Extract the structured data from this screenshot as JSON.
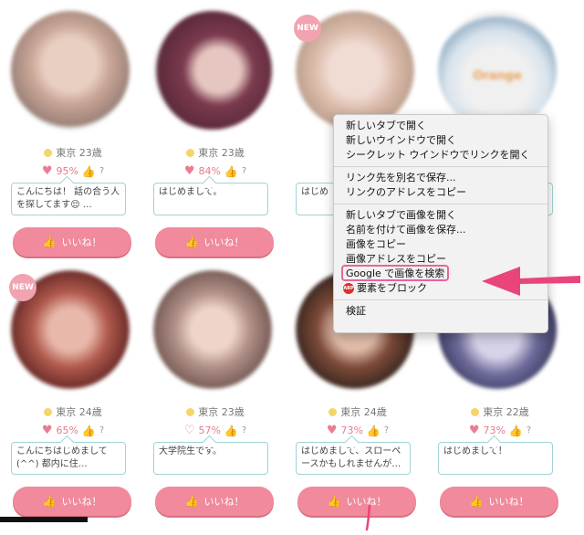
{
  "cards": [
    {
      "new": "",
      "location": "東京 23歳",
      "rate": "95%",
      "question": "?",
      "message": "こんにちは！ 話の合う人を探してます😌 …",
      "like_label": "いいね！"
    },
    {
      "new": "",
      "location": "東京 23歳",
      "rate": "84%",
      "question": "?",
      "message": "はじめまして。",
      "like_label": "いいね！"
    },
    {
      "new": "NEW",
      "location": "",
      "rate": "",
      "question": "",
      "message": "はじめ",
      "like_label": ""
    },
    {
      "new": "",
      "location": "",
      "rate": "",
      "question": "",
      "message": "合",
      "like_label": ""
    },
    {
      "new": "NEW",
      "location": "東京 24歳",
      "rate": "65%",
      "question": "?",
      "message": "こんにちはじめまして(^^) 都内に住…",
      "like_label": "いいね！"
    },
    {
      "new": "",
      "location": "東京 23歳",
      "rate": "57%",
      "question": "?",
      "message": "大学院生です。",
      "like_label": "いいね！"
    },
    {
      "new": "",
      "location": "東京 24歳",
      "rate": "73%",
      "question": "?",
      "message": "はじめまして、スローペースかもしれませんが…",
      "like_label": "いいね！"
    },
    {
      "new": "",
      "location": "東京 22歳",
      "rate": "73%",
      "question": "?",
      "message": "はじめまして！",
      "like_label": "いいね！"
    }
  ],
  "shirt_text": "Orange",
  "context_menu": {
    "group1": [
      "新しいタブで開く",
      "新しいウインドウで開く",
      "シークレット ウインドウでリンクを開く"
    ],
    "group2": [
      "リンク先を別名で保存...",
      "リンクのアドレスをコピー"
    ],
    "group3": [
      "新しいタブで画像を開く",
      "名前を付けて画像を保存...",
      "画像をコピー",
      "画像アドレスをコピー"
    ],
    "google_search": "Google で画像を検索",
    "block_element": "要素をブロック",
    "abp_label": "ABP",
    "inspect": "検証"
  },
  "colors": {
    "accent_pink": "#f08a9c",
    "highlight": "#e9639c",
    "arrow": "#e9457a",
    "teal_border": "#9fd2d6"
  }
}
